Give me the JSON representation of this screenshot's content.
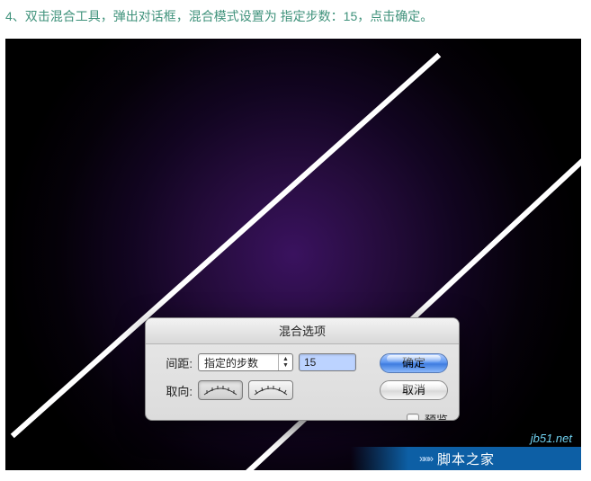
{
  "instruction": "4、双击混合工具，弹出对话框，混合模式设置为 指定步数：15，点击确定。",
  "dialog": {
    "title": "混合选项",
    "spacing_label": "间距:",
    "spacing_mode": "指定的步数",
    "spacing_value": "15",
    "orientation_label": "取向:",
    "ok_label": "确定",
    "cancel_label": "取消",
    "preview_label": "预览",
    "preview_checked": false
  },
  "watermark": {
    "url": "jb51.net",
    "site_name": "脚本之家"
  },
  "colors": {
    "accent_purple": "#3a125f",
    "link_blue": "#0d5fa5",
    "instruction_color": "#3f927b"
  }
}
